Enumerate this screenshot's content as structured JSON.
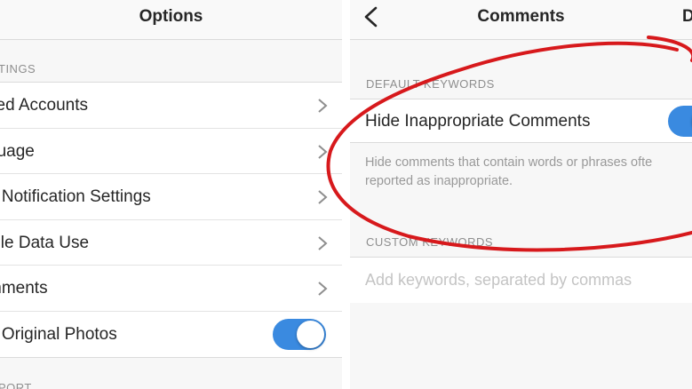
{
  "options": {
    "title": "Options",
    "settings_header": "TINGS",
    "items": [
      {
        "label": "ked Accounts",
        "control": "chevron"
      },
      {
        "label": "guage",
        "control": "chevron"
      },
      {
        "label": "h Notification Settings",
        "control": "chevron"
      },
      {
        "label": "bile Data Use",
        "control": "chevron"
      },
      {
        "label": "mments",
        "control": "chevron"
      },
      {
        "label": "e Original Photos",
        "control": "toggle",
        "on": true
      }
    ],
    "support_header": "PORT"
  },
  "comments": {
    "title": "Comments",
    "back_icon": "chevron-left-icon",
    "done_label": "D",
    "default_header": "DEFAULT KEYWORDS",
    "hide_label": "Hide Inappropriate Comments",
    "hide_on": true,
    "description_line1": "Hide comments that contain words or phrases ofte",
    "description_line2": "reported as inappropriate.",
    "custom_header": "CUSTOM KEYWORDS",
    "keywords_placeholder": "Add keywords, separated by commas",
    "keywords_value": ""
  },
  "colors": {
    "toggle_on": "#3a8ae0",
    "annotation": "#d7191c"
  }
}
